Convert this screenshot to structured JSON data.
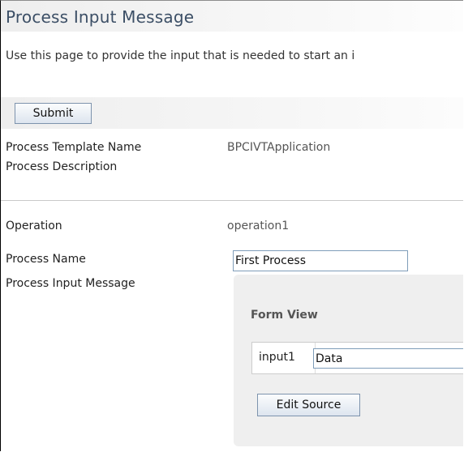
{
  "page": {
    "title": "Process Input Message",
    "intro": "Use this page to provide the input that is needed to start an i"
  },
  "toolbar": {
    "submit_label": "Submit"
  },
  "details": {
    "template_name_label": "Process Template Name",
    "template_name_value": "BPCIVTApplication",
    "description_label": "Process Description",
    "operation_label": "Operation",
    "operation_value": "operation1",
    "process_name_label": "Process Name",
    "process_name_value": "First Process",
    "input_message_label": "Process Input Message"
  },
  "form_view": {
    "heading": "Form View",
    "field_label": "input1",
    "field_value": "Data",
    "edit_source_label": "Edit Source"
  }
}
